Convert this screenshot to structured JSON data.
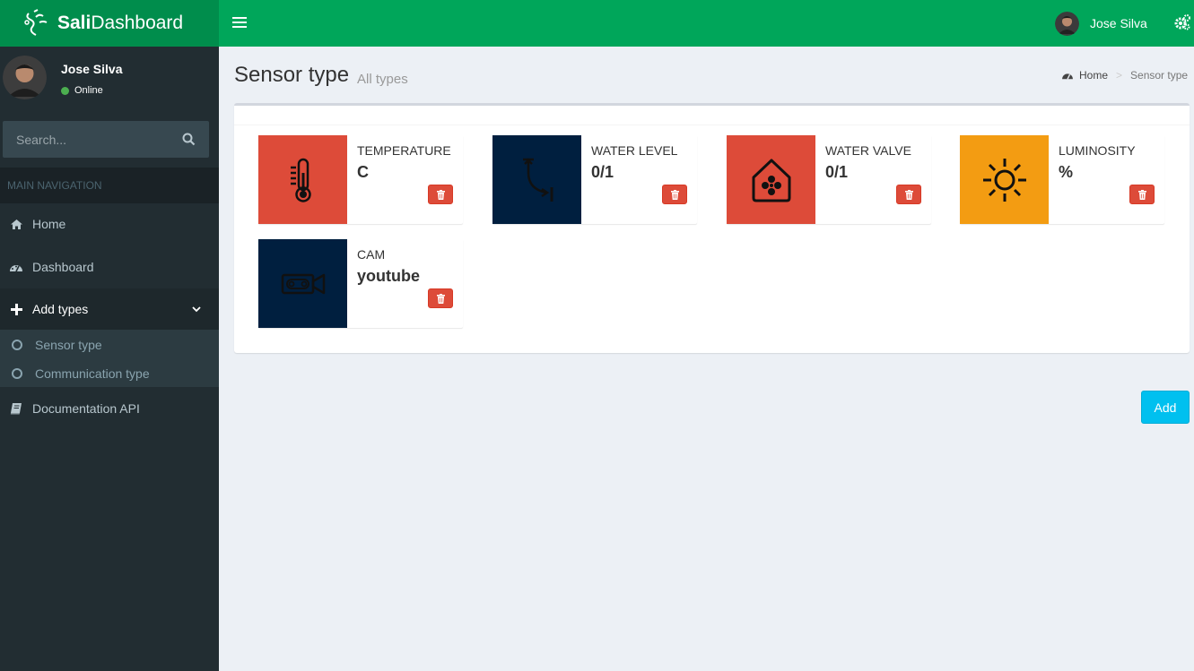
{
  "brand": {
    "bold": "Sali",
    "rest": "Dashboard"
  },
  "header": {
    "user_name": "Jose Silva"
  },
  "sidebar": {
    "user": {
      "name": "Jose Silva",
      "status": "Online"
    },
    "search": {
      "placeholder": "Search..."
    },
    "section_header": "MAIN NAVIGATION",
    "items": [
      {
        "label": "Home",
        "icon": "home-icon"
      },
      {
        "label": "Dashboard",
        "icon": "dashboard-icon"
      },
      {
        "label": "Add types",
        "icon": "plus-icon"
      },
      {
        "label": "Documentation API",
        "icon": "book-icon"
      }
    ],
    "subitems": [
      {
        "label": "Sensor type",
        "icon": "circle-icon"
      },
      {
        "label": "Communication type",
        "icon": "circle-icon"
      }
    ]
  },
  "page": {
    "title": "Sensor type",
    "subtitle": "All types",
    "breadcrumb": {
      "home": "Home",
      "current": "Sensor type"
    }
  },
  "sensor_types": [
    {
      "name": "TEMPERATURE",
      "unit": "C",
      "icon": "thermometer-icon",
      "color": "#dd4b39"
    },
    {
      "name": "WATER LEVEL",
      "unit": "0/1",
      "icon": "water-pipe-icon",
      "color": "#001f3f"
    },
    {
      "name": "WATER VALVE",
      "unit": "0/1",
      "icon": "valve-house-icon",
      "color": "#dd4b39"
    },
    {
      "name": "LUMINOSITY",
      "unit": "%",
      "icon": "sun-icon",
      "color": "#f39c12"
    },
    {
      "name": "CAM",
      "unit": "youtube",
      "icon": "camera-icon",
      "color": "#001f3f"
    }
  ],
  "actions": {
    "add_label": "Add"
  },
  "colors": {
    "header": "#00a65a",
    "logo_bg": "#008d4c",
    "sidebar": "#222d32",
    "danger": "#dd4b39",
    "info": "#00c0ef"
  }
}
